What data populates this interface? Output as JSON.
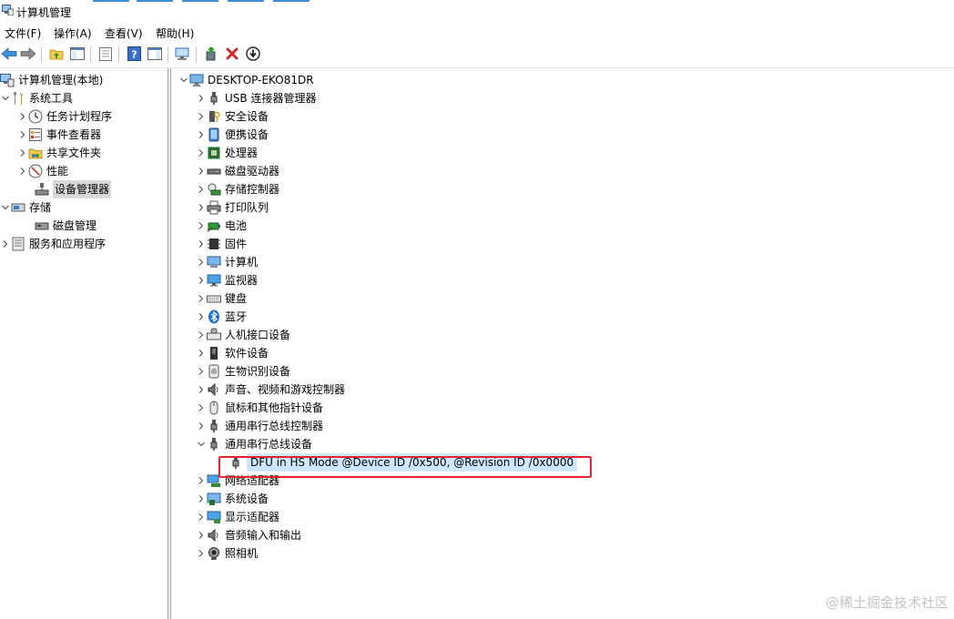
{
  "window": {
    "title": "计算机管理"
  },
  "menu": [
    "文件(F)",
    "操作(A)",
    "查看(V)",
    "帮助(H)"
  ],
  "toolbar": {
    "icons": [
      "back-icon",
      "forward-icon",
      "up-folder-icon",
      "show-hide-tree-icon",
      "properties-icon",
      "help-icon",
      "show-action-pane-icon",
      "scan-hardware-icon",
      "update-driver-icon",
      "uninstall-icon",
      "disable-icon"
    ]
  },
  "left_tree": {
    "root": "计算机管理(本地)",
    "system_tools": "系统工具",
    "task_scheduler": "任务计划程序",
    "event_viewer": "事件查看器",
    "shared_folders": "共享文件夹",
    "performance": "性能",
    "device_manager": "设备管理器",
    "storage": "存储",
    "disk_management": "磁盘管理",
    "services_apps": "服务和应用程序"
  },
  "device_tree": {
    "computer": "DESKTOP-EKO81DR",
    "categories": [
      "USB 连接器管理器",
      "安全设备",
      "便携设备",
      "处理器",
      "磁盘驱动器",
      "存储控制器",
      "打印队列",
      "电池",
      "固件",
      "计算机",
      "监视器",
      "键盘",
      "蓝牙",
      "人机接口设备",
      "软件设备",
      "生物识别设备",
      "声音、视频和游戏控制器",
      "鼠标和其他指针设备",
      "通用串行总线控制器",
      "通用串行总线设备",
      "网络适配器",
      "系统设备",
      "显示适配器",
      "音频输入和输出",
      "照相机"
    ],
    "expanded_child": "DFU in HS Mode @Device ID /0x500, @Revision ID /0x0000"
  },
  "watermark": "@稀土掘金技术社区",
  "colors": {
    "highlight_box": "#e5262c",
    "selection": "#cde8ff",
    "accent": "#3c8fd8"
  }
}
